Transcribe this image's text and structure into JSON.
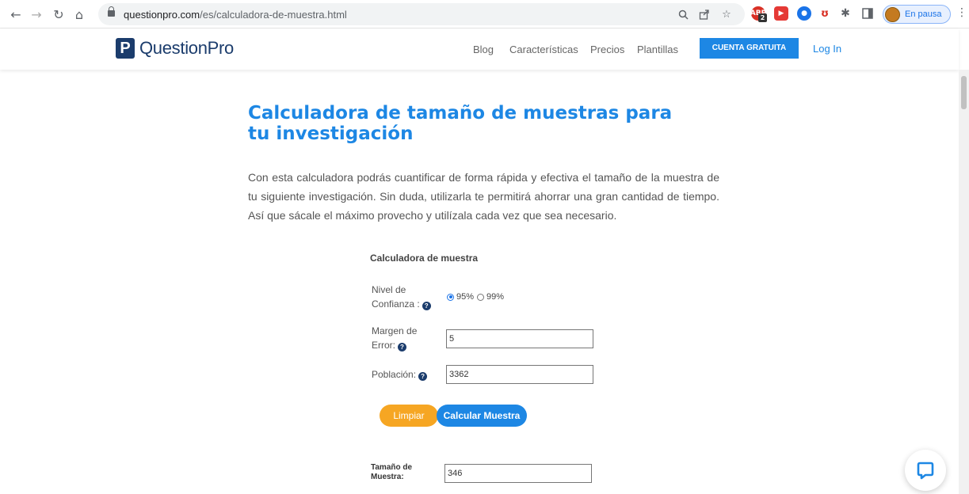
{
  "browser": {
    "url_host": "questionpro.com",
    "url_path": "/es/calculadora-de-muestra.html",
    "profile_label": "En pausa",
    "icons": [
      "back-icon",
      "forward-icon",
      "reload-icon",
      "home-icon",
      "lock-icon",
      "zoom-icon",
      "share-icon",
      "star-icon",
      "extensions-icon",
      "sidepanel-icon",
      "menu-icon"
    ],
    "extension_badge": "2"
  },
  "header": {
    "logo_letter": "P",
    "logo_text": "QuestionPro",
    "nav": {
      "blog": "Blog",
      "features": "Características",
      "pricing": "Precios",
      "templates": "Plantillas"
    },
    "cta": "CUENTA GRATUITA",
    "login": "Log In"
  },
  "content": {
    "title": "Calculadora de tamaño de muestras para tu investigación",
    "intro": "Con esta calculadora podrás cuantificar de forma rápida y efectiva el tamaño de la muestra de tu siguiente investigación. Sin duda, utilizarla te permitirá ahorrar una gran cantidad de tiempo. Así que sácale el máximo provecho y utilízala cada vez que sea necesario."
  },
  "calculator": {
    "title": "Calculadora de muestra",
    "confidence": {
      "label_line1": "Nivel de",
      "label_line2": "Confianza :",
      "options": [
        "95%",
        "99%"
      ],
      "selected": "95%"
    },
    "margin": {
      "label_line1": "Margen de",
      "label_line2": "Error:",
      "value": "5"
    },
    "population": {
      "label": "Población:",
      "value": "3362"
    },
    "buttons": {
      "clear": "Limpiar",
      "calculate": "Calcular Muestra"
    },
    "result": {
      "label_line1": "Tamaño de",
      "label_line2": "Muestra:",
      "value": "346"
    },
    "help_glyph": "?"
  },
  "colors": {
    "brand_blue": "#1d87e4",
    "brand_navy": "#1b3c6c",
    "clear_button": "#f6a623"
  }
}
